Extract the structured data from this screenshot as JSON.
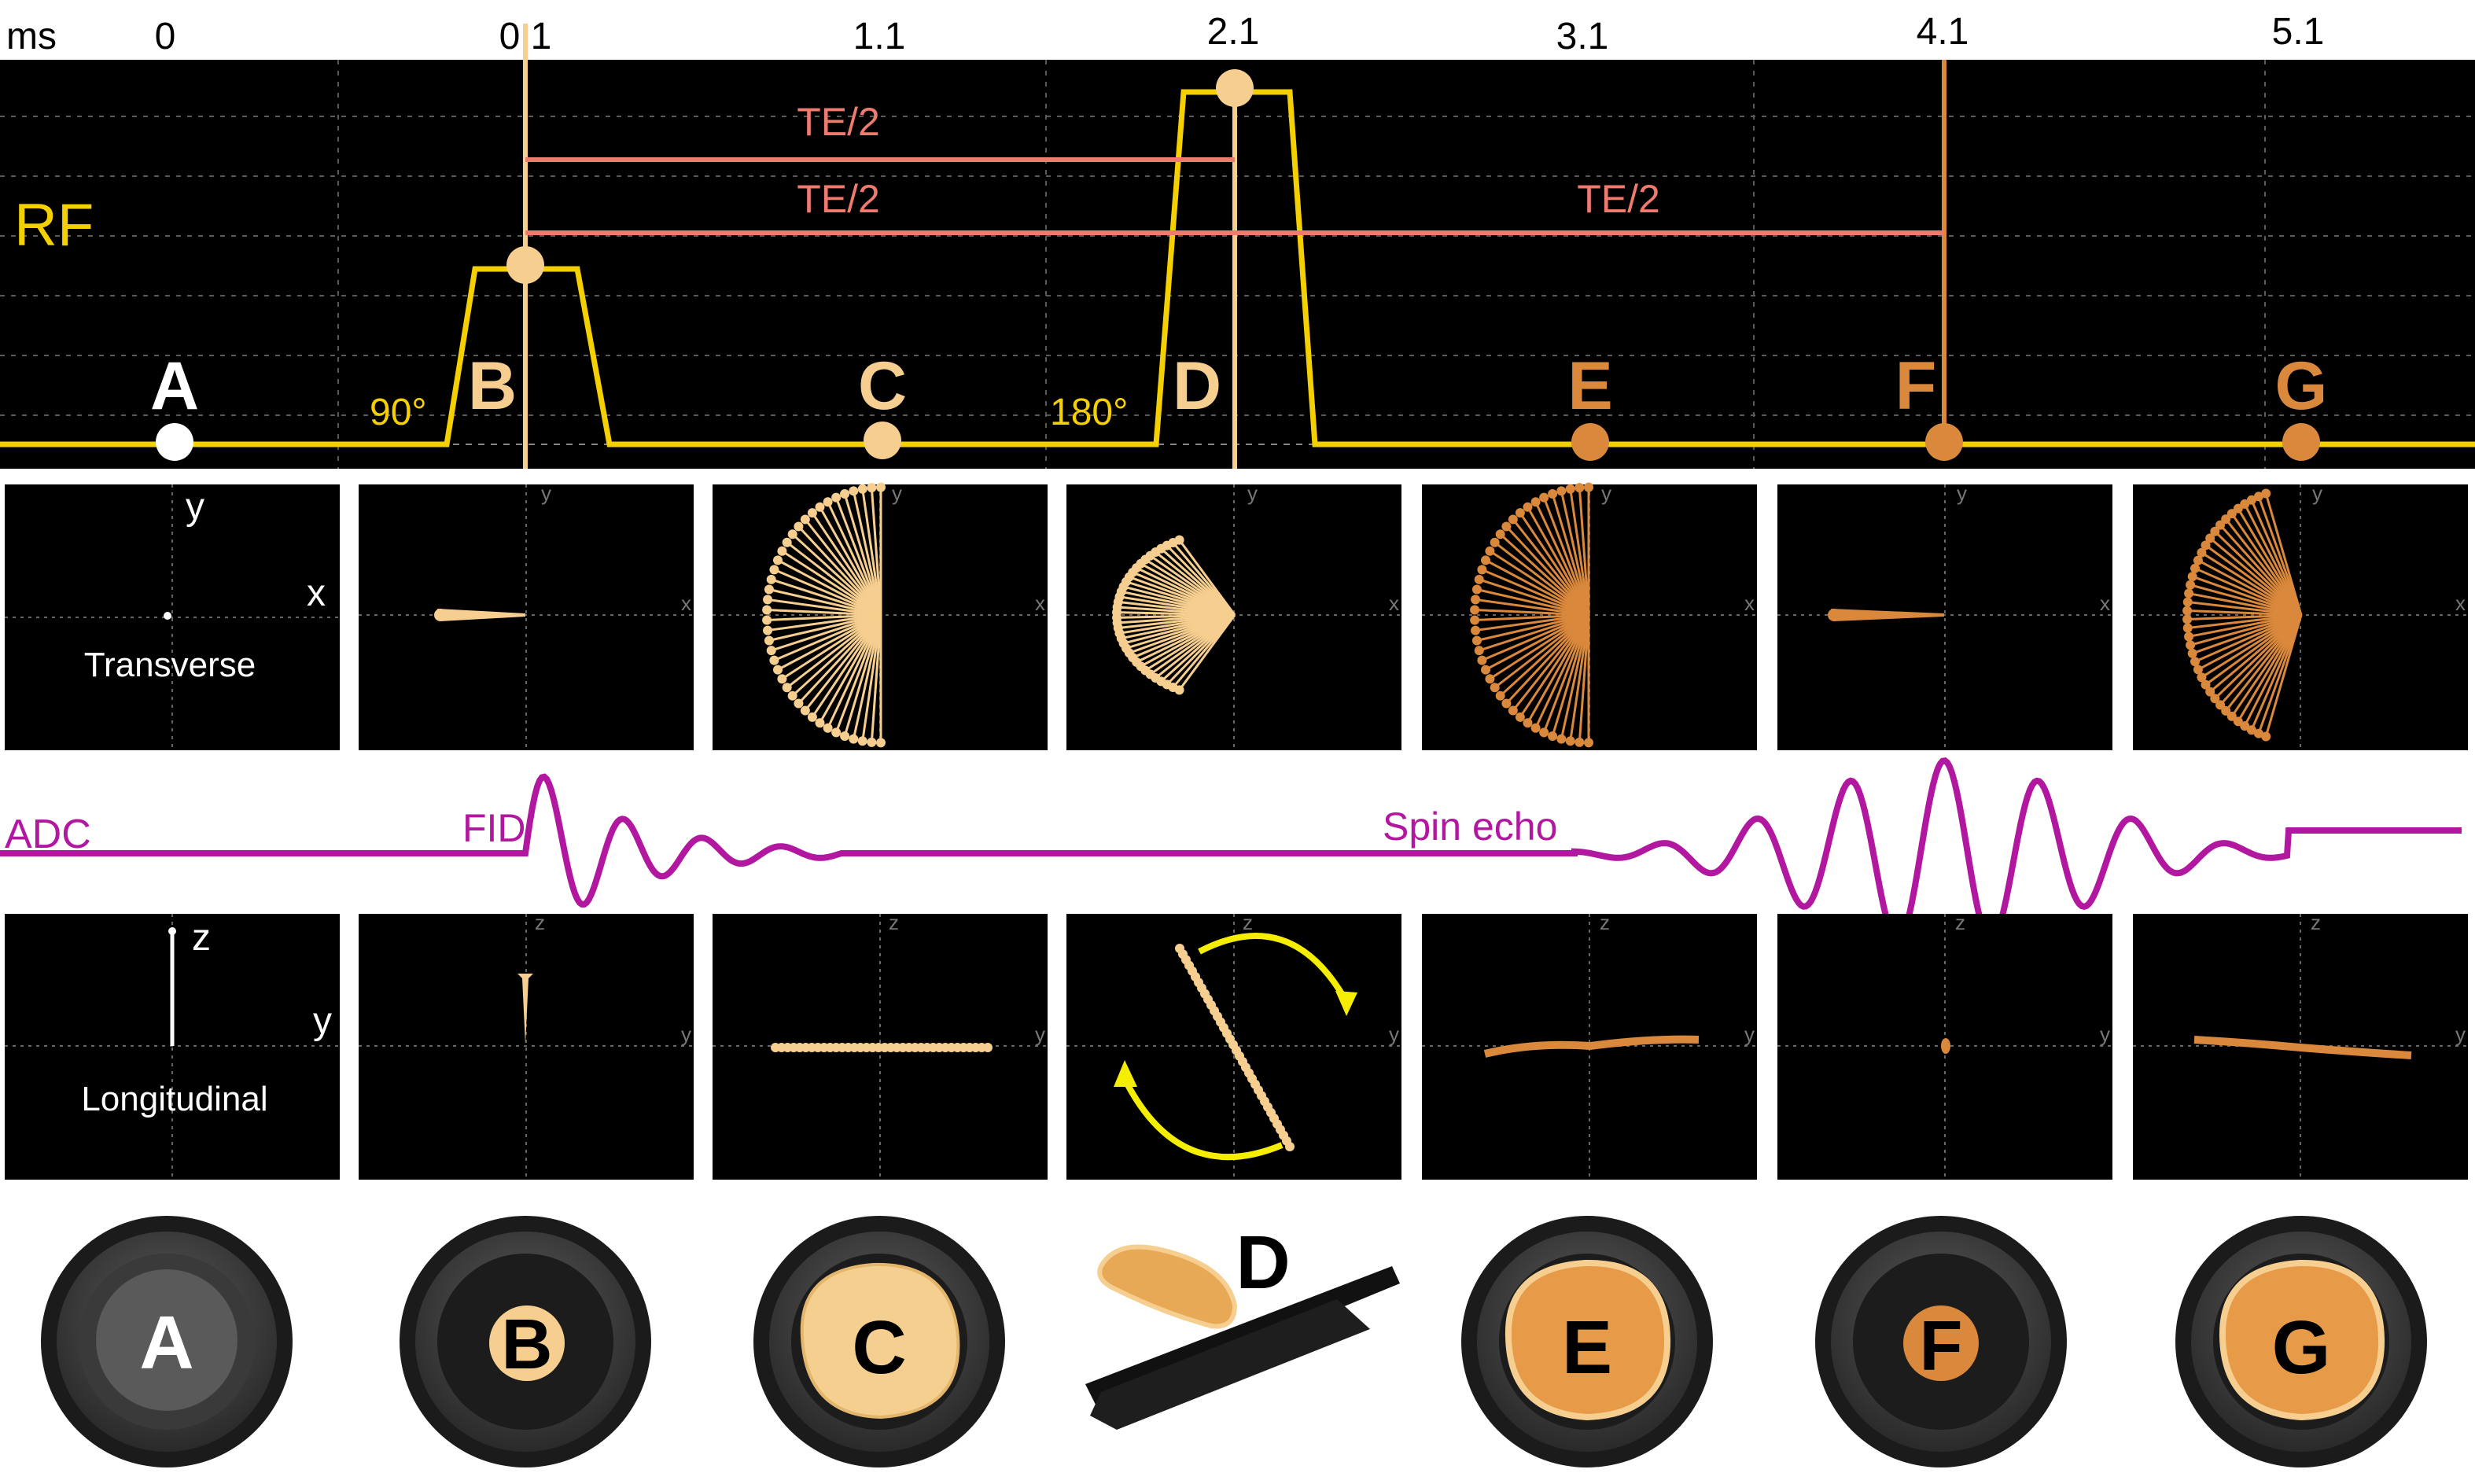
{
  "colors": {
    "background": "#ffffff",
    "panel": "#000000",
    "rf_line": "#f5d000",
    "te_line": "#ef7a6e",
    "adc": "#b1179f",
    "white_spin": "#ffffff",
    "cream_spin": "#f6cf90",
    "orange_spin": "#d9883c",
    "pan_rim": "#2c2c2c",
    "yellow_arrow": "#f5ee00"
  },
  "rf_panel": {
    "axis_unit": "ms",
    "times": [
      "0",
      "0.1",
      "1.1",
      "2.1",
      "3.1",
      "4.1",
      "5.1"
    ],
    "rf_label": "RF",
    "flip_90": "90°",
    "flip_180": "180°",
    "te_labels": [
      "TE/2",
      "TE/2",
      "TE/2"
    ],
    "points": [
      "A",
      "B",
      "C",
      "D",
      "E",
      "F",
      "G"
    ]
  },
  "transverse": {
    "title": "Transverse",
    "axis_x": "x",
    "axis_y": "y"
  },
  "adc": {
    "label": "ADC",
    "fid_label": "FID",
    "echo_label": "Spin echo"
  },
  "longitudinal": {
    "title": "Longitudinal",
    "axis_y": "y",
    "axis_z": "z"
  },
  "pans": [
    "A",
    "B",
    "C",
    "D",
    "E",
    "F",
    "G"
  ]
}
